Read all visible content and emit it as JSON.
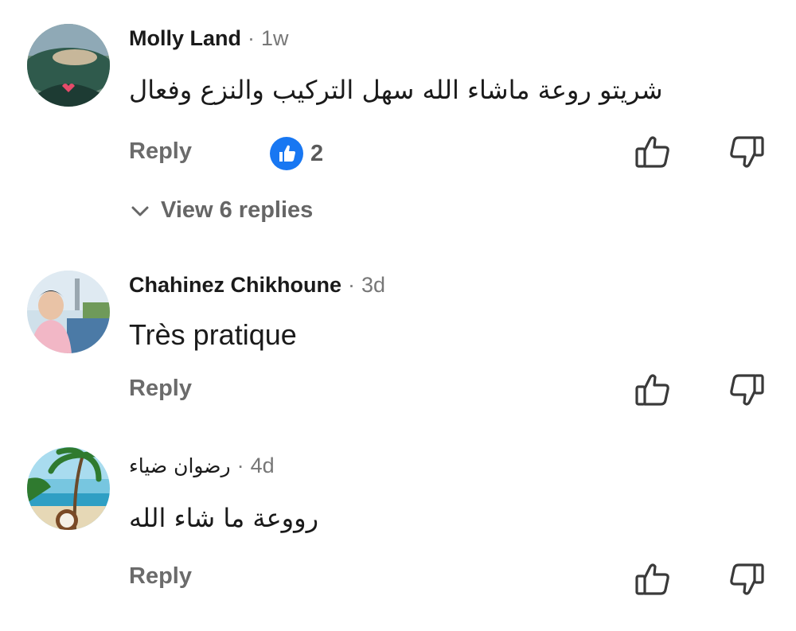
{
  "comments": [
    {
      "author": "Molly Land",
      "separator": "·",
      "time": "1w",
      "text": "شريتو روعة ماشاء الله سهل التركيب والنزع وفعال",
      "reply_label": "Reply",
      "reaction_count": "2",
      "reaction_icon": "like-badge-icon",
      "view_replies_label": "View 6 replies"
    },
    {
      "author": "Chahinez Chikhoune",
      "separator": "·",
      "time": "3d",
      "text": "Très pratique",
      "reply_label": "Reply"
    },
    {
      "author": "رضوان ضياء",
      "separator": "·",
      "time": "4d",
      "text": "رووعة ما شاء الله",
      "reply_label": "Reply"
    }
  ],
  "icons": {
    "like": "thumbs-up-outline-icon",
    "dislike": "thumbs-down-outline-icon",
    "expand": "chevron-down-icon"
  },
  "colors": {
    "like_badge": "#1877F2",
    "secondary_text": "#6b6b6b",
    "primary_text": "#1a1a1a"
  }
}
